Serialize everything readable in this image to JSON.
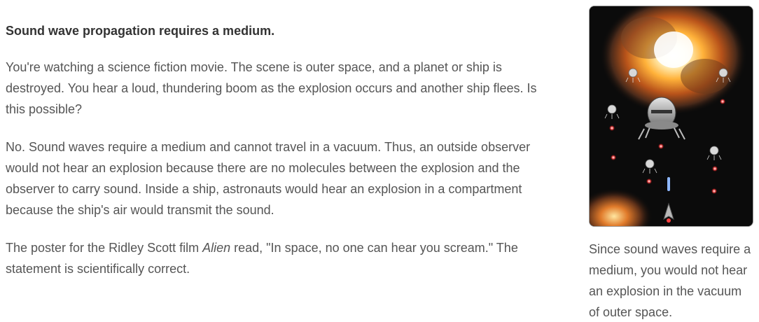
{
  "article": {
    "heading": "Sound wave propagation requires a medium.",
    "paragraph1": "You're watching a science fiction movie. The scene is outer space, and a planet or ship is destroyed. You hear a loud, thundering boom as the explosion occurs and another ship flees. Is this possible?",
    "paragraph2": "No. Sound waves require a medium and cannot travel in a vacuum. Thus, an outside observer would not hear an explosion because there are no molecules between the explosion and the observer to carry sound. Inside a ship, astronauts would hear an explosion in a compartment because the ship's air would transmit the sound.",
    "paragraph3": {
      "before": "The poster for the Ridley Scott film ",
      "film_title": "Alien",
      "after": " read, \"In space, no one can hear you scream.\" The statement is scientifically correct."
    }
  },
  "figure": {
    "caption": "Since sound waves require a medium, you would not hear an explosion in the vacuum of outer space."
  }
}
